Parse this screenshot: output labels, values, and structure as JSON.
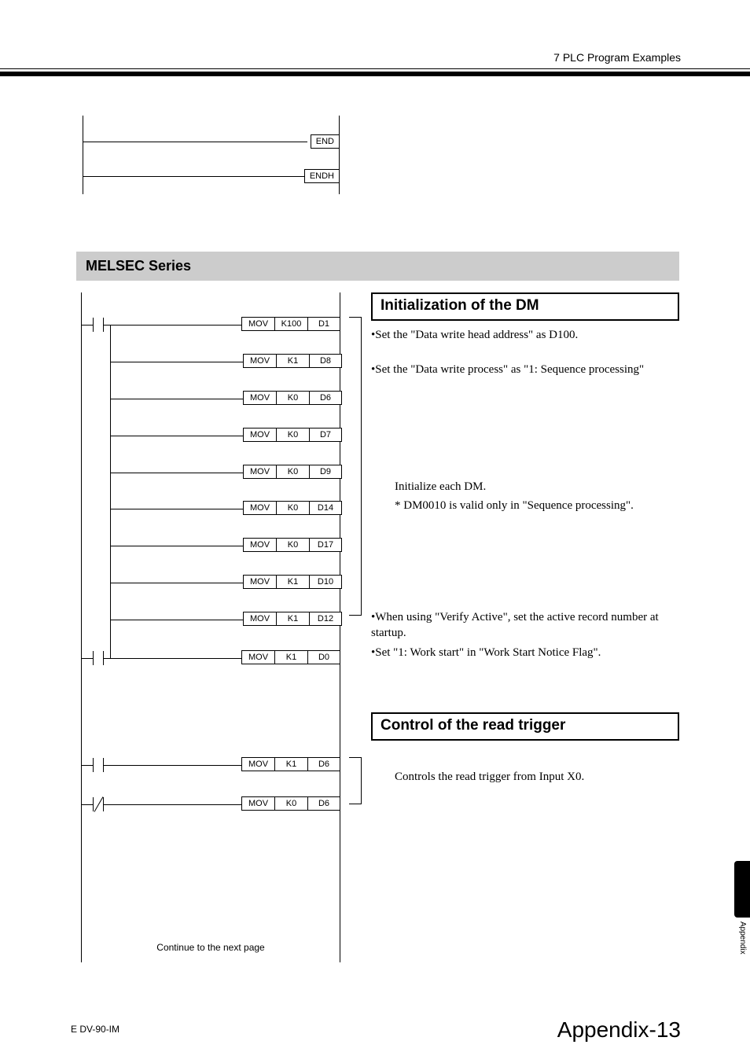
{
  "header": {
    "chapter": "7  PLC Program Examples"
  },
  "ladder_top": {
    "instr1": "END",
    "instr2": "ENDH"
  },
  "section_bar": "MELSEC Series",
  "ladder_rows": [
    {
      "op": "MOV",
      "a": "K100",
      "b": "D1"
    },
    {
      "op": "MOV",
      "a": "K1",
      "b": "D8"
    },
    {
      "op": "MOV",
      "a": "K0",
      "b": "D6"
    },
    {
      "op": "MOV",
      "a": "K0",
      "b": "D7"
    },
    {
      "op": "MOV",
      "a": "K0",
      "b": "D9"
    },
    {
      "op": "MOV",
      "a": "K0",
      "b": "D14"
    },
    {
      "op": "MOV",
      "a": "K0",
      "b": "D17"
    },
    {
      "op": "MOV",
      "a": "K1",
      "b": "D10"
    },
    {
      "op": "MOV",
      "a": "K1",
      "b": "D12"
    },
    {
      "op": "MOV",
      "a": "K1",
      "b": "D0"
    },
    {
      "op": "MOV",
      "a": "K1",
      "b": "D6"
    },
    {
      "op": "MOV",
      "a": "K0",
      "b": "D6"
    }
  ],
  "continue_note": "Continue to the next page",
  "desc": {
    "init_title": "Initialization of the DM",
    "init_b1": "•Set the \"Data write head address\" as D100.",
    "init_b2": "•Set the \"Data write process\" as \"1: Sequence processing\"",
    "init_m1": "Initialize each DM.",
    "init_m2": " * DM0010 is valid only in \"Sequence processing\".",
    "init_b3": "•When using \"Verify Active\", set the active record number at startup.",
    "init_b4": "•Set \"1: Work start\" in \"Work Start Notice Flag\".",
    "ctrl_title": "Control of the read trigger",
    "ctrl_b1": "Controls the read trigger from Input X0."
  },
  "side_tab": "Appendix",
  "footer": {
    "left": "E DV-90-IM",
    "right": "Appendix-13"
  }
}
